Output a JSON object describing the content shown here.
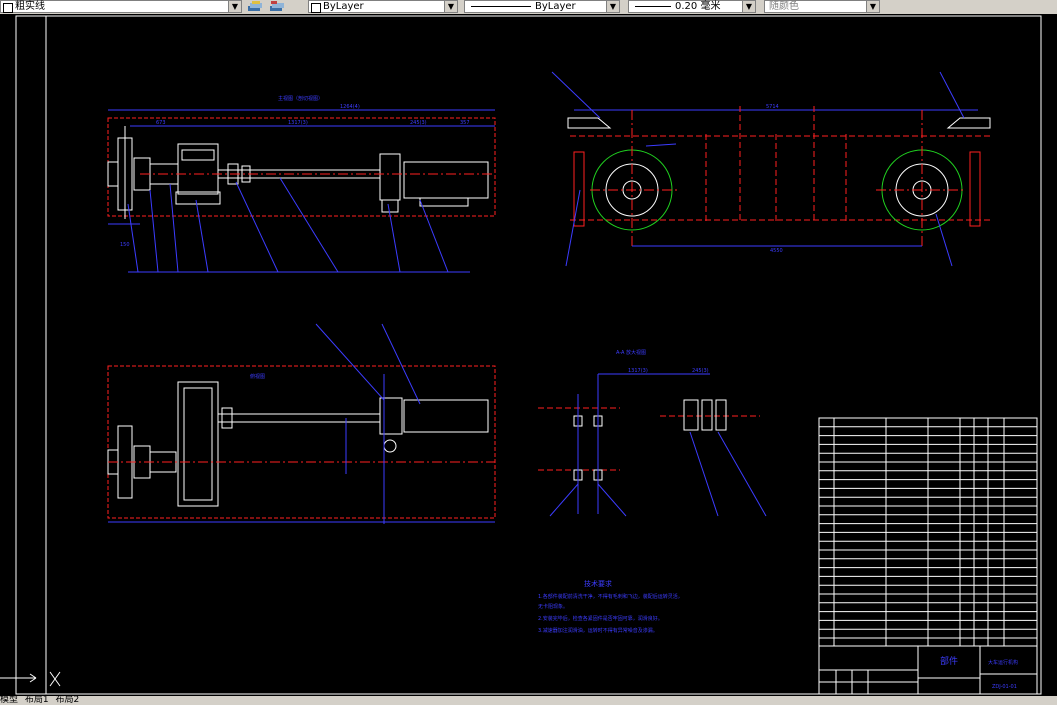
{
  "toolbar": {
    "linetype_label": "粗实线",
    "color_label": "ByLayer",
    "linetype2_label": "ByLayer",
    "lineweight_label": "0.20 毫米",
    "plotstyle_label": "随颜色"
  },
  "tabs": {
    "model": "模型",
    "layout1": "布局1",
    "layout2": "布局2"
  },
  "drawing": {
    "view1_title": "主视图（剖切视图）",
    "dim_total": "1264(4)",
    "dim_d1": "673",
    "dim_d2": "1317(3)",
    "dim_d3": "245(3)",
    "dim_d4": "357",
    "dim_left": "150",
    "dim_right_total": "5714",
    "dim_right_bottom": "4550",
    "view2_title": "俯视图",
    "detail_title": "A-A 放大视图",
    "detail_dim1": "1317(3)",
    "detail_dim2": "245(3)",
    "notes_title": "技术要求",
    "note1": "1.各部件装配前清洗干净，不得有毛刺和飞边，装配后运转灵活，",
    "note1b": "无卡阻现象。",
    "note2": "2.安装完毕后，检查各紧固件是否牢固可靠，润滑良好。",
    "note3": "3.减速器加注润滑油，运转时不得有异常噪音及渗漏。",
    "title_name": "部件",
    "title_drawing": "大车运行机构",
    "title_code": "ZDJ-01-01"
  },
  "colors": {
    "canvas": "#000000",
    "dim_blue": "#3c3cff",
    "red": "#ff2020",
    "white": "#ffffff",
    "green": "#20d020",
    "toolbar": "#d4d0c8"
  }
}
